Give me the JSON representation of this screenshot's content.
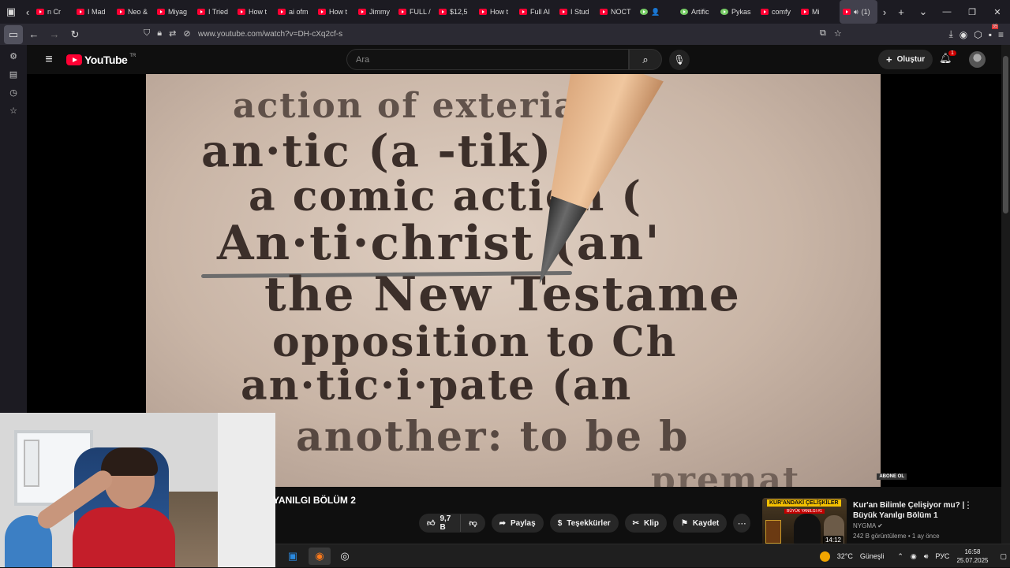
{
  "browser": {
    "tabs": [
      {
        "label": "n Cr"
      },
      {
        "label": "I Mad"
      },
      {
        "label": "Neo &"
      },
      {
        "label": "Miyag"
      },
      {
        "label": "I Tried"
      },
      {
        "label": "How t"
      },
      {
        "label": "ai ofm"
      },
      {
        "label": "How t"
      },
      {
        "label": "Jimmy"
      },
      {
        "label": "FULL /"
      },
      {
        "label": "$12,5"
      },
      {
        "label": "How t"
      },
      {
        "label": "Full AI"
      },
      {
        "label": "I Stud"
      },
      {
        "label": "NOCT"
      },
      {
        "label": "👤"
      },
      {
        "label": "Artific"
      },
      {
        "label": "Pykas"
      },
      {
        "label": "comfy"
      },
      {
        "label": "Mi"
      },
      {
        "label": "(1)"
      }
    ],
    "url": "www.youtube.com/watch?v=DH-cXq2cf-s",
    "extensions_badge": "35"
  },
  "youtube": {
    "logo_text": "YouTube",
    "country_code": "TR",
    "search_placeholder": "Ara",
    "create_label": "Oluştur",
    "notification_count": "1"
  },
  "video": {
    "frame_lines": [
      "action of exteria",
      "an·tic (a -tik) a",
      "a comic action (",
      "An·ti·christ (an'",
      "the New Testame",
      "opposition to Ch",
      "an·tic·i·pate (an",
      "another: to be b",
      "premat"
    ],
    "subscribe_watermark": "ABONE OL",
    "title": "YANILGI BÖLÜM 2",
    "like_count": "9,7 B",
    "share_label": "Paylaş",
    "thanks_label": "Teşekkürler",
    "clip_label": "Klip",
    "save_label": "Kaydet"
  },
  "recommendation": {
    "thumb_banner": "KUR'ANDAKİ ÇELİŞKİLER",
    "thumb_sub": "BÜYÜK YANILGI #1",
    "duration": "14:12",
    "title": "Kur'an Bilimle Çelişiyor mu? | Büyük Yanılgı Bölüm 1",
    "channel": "NYGMA",
    "meta": "242 B görüntüleme • 1 ay önce"
  },
  "taskbar": {
    "weather": "32°C",
    "weather_label": "Güneşli",
    "lang": "РУС",
    "time": "16:58",
    "date": "25.07.2025"
  },
  "colors": {
    "youtube_red": "#ff0033",
    "background": "#0f0f0f",
    "pill": "#272727"
  }
}
